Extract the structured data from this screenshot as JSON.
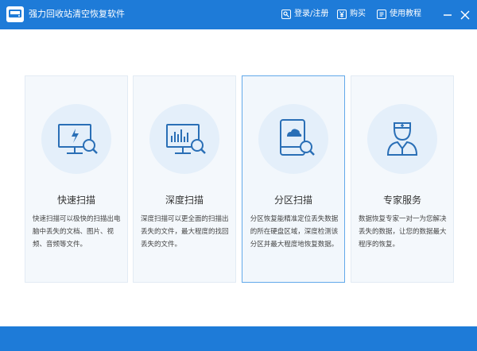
{
  "titlebar": {
    "app_title": "强力回收站清空恢复软件",
    "login_label": "登录/注册",
    "buy_label": "购买",
    "tutorial_label": "使用教程",
    "accent": "#1e7bd8"
  },
  "cards": [
    {
      "icon": "monitor-flash-search-icon",
      "title": "快速扫描",
      "desc": "快速扫描可以极快的扫描出电脑中丢失的文档、图片、视频、音频等文件。"
    },
    {
      "icon": "monitor-chart-search-icon",
      "title": "深度扫描",
      "desc": "深度扫描可以更全面的扫描出丢失的文件，最大程度的找回丢失的文件。"
    },
    {
      "icon": "drive-cloud-search-icon",
      "title": "分区扫描",
      "desc": "分区恢复能精准定位丢失数据的所在硬盘区域，深度检测该分区并最大程度地恢复数据。"
    },
    {
      "icon": "expert-person-icon",
      "title": "专家服务",
      "desc": "数据恢复专家一对一为您解决丢失的数据，让您的数据最大程序的恢复。"
    }
  ]
}
